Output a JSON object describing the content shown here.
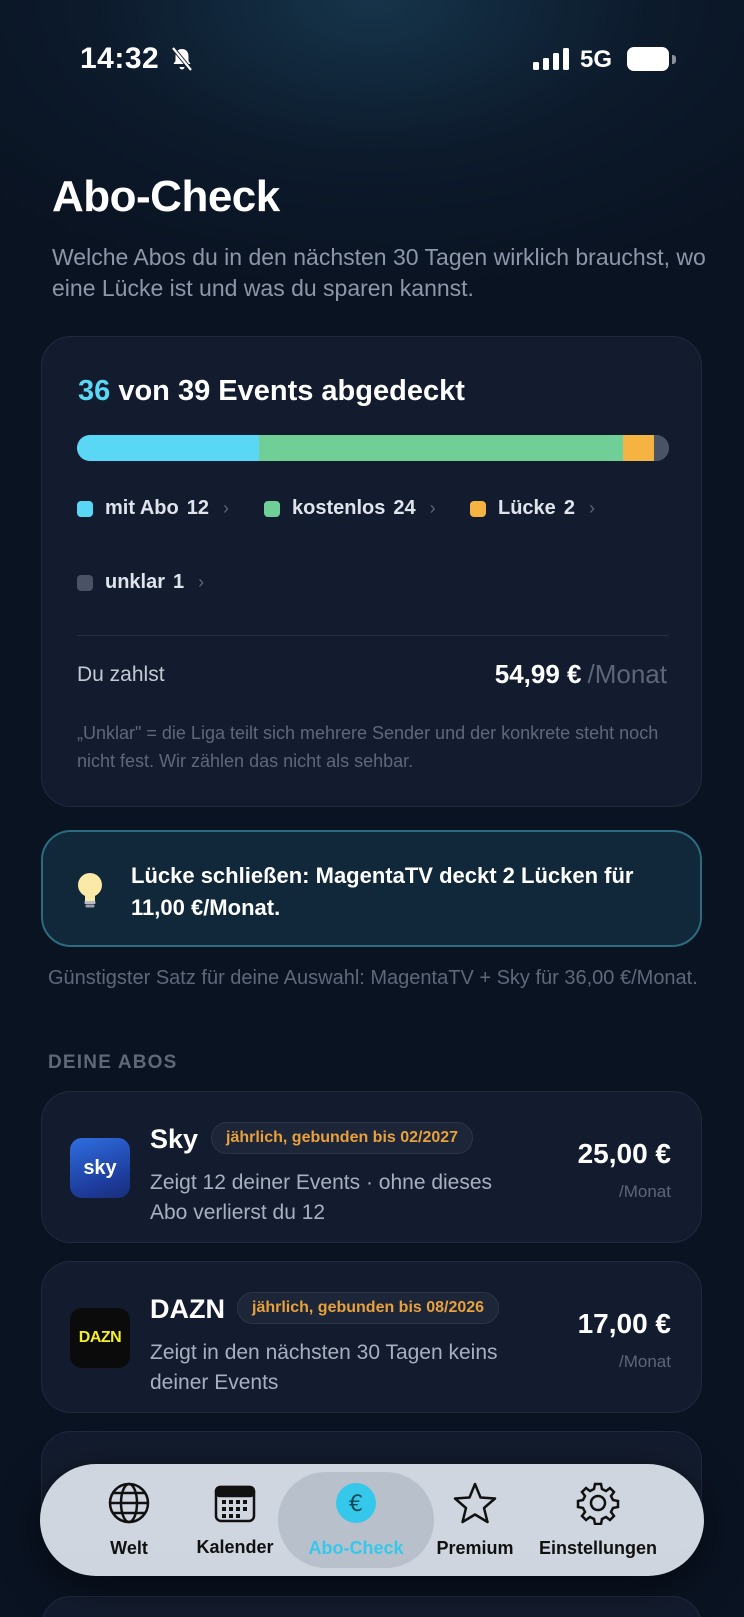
{
  "status_bar": {
    "time": "14:32",
    "network": "5G"
  },
  "header": {
    "title": "Abo-Check",
    "subtitle": "Welche Abos du in den nächsten 30 Tagen wirklich brauchst, wo eine Lücke ist und was du sparen kannst."
  },
  "coverage": {
    "covered": "36",
    "title_rest": "von 39 Events abgedeckt",
    "total_events": 39,
    "legend": [
      {
        "label": "mit Abo",
        "count": "12",
        "color": "#5ad7f5"
      },
      {
        "label": "kostenlos",
        "count": "24",
        "color": "#6fcf97"
      },
      {
        "label": "Lücke",
        "count": "2",
        "color": "#f5b342"
      },
      {
        "label": "unklar",
        "count": "1",
        "color": "#4a5366"
      }
    ],
    "pay_label": "Du zahlst",
    "pay_amount": "54,99 €",
    "pay_unit": "/Monat",
    "note": "„Unklar\" = die Liga teilt sich mehrere Sender und der konkrete steht noch nicht fest. Wir zählen das nicht als sehbar."
  },
  "tip": {
    "text": "Lücke schließen: MagentaTV deckt 2 Lücken für 11,00 €/Monat.",
    "note": "Günstigster Satz für deine Auswahl: MagentaTV + Sky für 36,00 €/Monat."
  },
  "subscriptions": {
    "section_label": "DEINE ABOS",
    "items": [
      {
        "logo_text": "sky",
        "name": "Sky",
        "badge": "jährlich, gebunden bis 02/2027",
        "desc": "Zeigt 12 deiner Events · ohne dieses Abo verlierst du 12",
        "price": "25,00 €",
        "per": "/Monat"
      },
      {
        "logo_text": "DAZN",
        "name": "DAZN",
        "badge": "jährlich, gebunden bis 08/2026",
        "desc": "Zeigt in den nächsten 30 Tagen keins deiner Events",
        "price": "17,00 €",
        "per": "/Monat"
      }
    ]
  },
  "tab_bar": {
    "tabs": [
      {
        "label": "Welt",
        "icon": "globe-icon"
      },
      {
        "label": "Kalender",
        "icon": "calendar-icon"
      },
      {
        "label": "Abo-Check",
        "icon": "euro-icon",
        "active": true
      },
      {
        "label": "Premium",
        "icon": "star-icon"
      },
      {
        "label": "Einstellungen",
        "icon": "gear-icon"
      }
    ]
  }
}
